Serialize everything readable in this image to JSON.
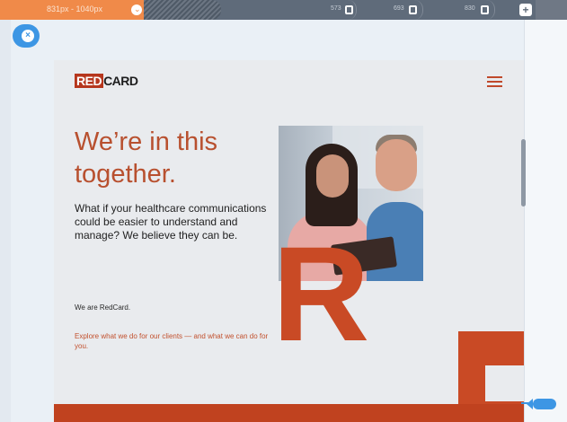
{
  "breakpoints": {
    "active_range": "831px - 1040px",
    "labels": [
      "573",
      "693",
      "830"
    ]
  },
  "editor": {
    "close_icon": "close-icon",
    "add_icon": "plus-icon",
    "add_glyph": "+",
    "close_glyph": "×",
    "knob_glyph": "⌄"
  },
  "site": {
    "logo_red": "RED",
    "logo_text": "CARD",
    "menu_icon": "hamburger-icon",
    "headline": "We’re in this together.",
    "subheadline": "What if your healthcare communications could be easier to understand and manage? We believe they can be.",
    "we_are": "We are RedCard.",
    "explore": "Explore what we do for our clients — and what we can do for you.",
    "big_letters": [
      "R",
      "E"
    ],
    "colors": {
      "brand_red": "#c94a25",
      "headline": "#b8502f",
      "background": "#e9ebee"
    }
  },
  "colors": {
    "accent": "#3d96e4",
    "active_breakpoint": "#f08a49",
    "toolbar": "#5f6b7a"
  }
}
